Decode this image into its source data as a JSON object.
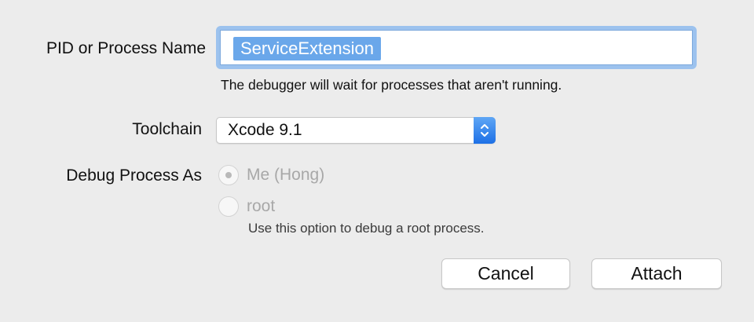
{
  "form": {
    "pid_label": "PID or Process Name",
    "pid_value": "ServiceExtension",
    "pid_hint": "The debugger will wait for processes that aren't running.",
    "toolchain_label": "Toolchain",
    "toolchain_value": "Xcode 9.1",
    "debug_as_label": "Debug Process As",
    "radio_me_label": "Me (Hong)",
    "radio_root_label": "root",
    "root_hint": "Use this option to debug a root process."
  },
  "buttons": {
    "cancel_label": "Cancel",
    "attach_label": "Attach"
  },
  "colors": {
    "background": "#ececec",
    "focus_ring": "#9cc2ee",
    "selection": "#6aa7ea",
    "stepper_accent": "#1d70e6",
    "disabled_text": "#a8a8a8"
  },
  "icons": {
    "popup_stepper": "chevron-up-down-icon",
    "radio_selected": "radio-dot-icon"
  }
}
